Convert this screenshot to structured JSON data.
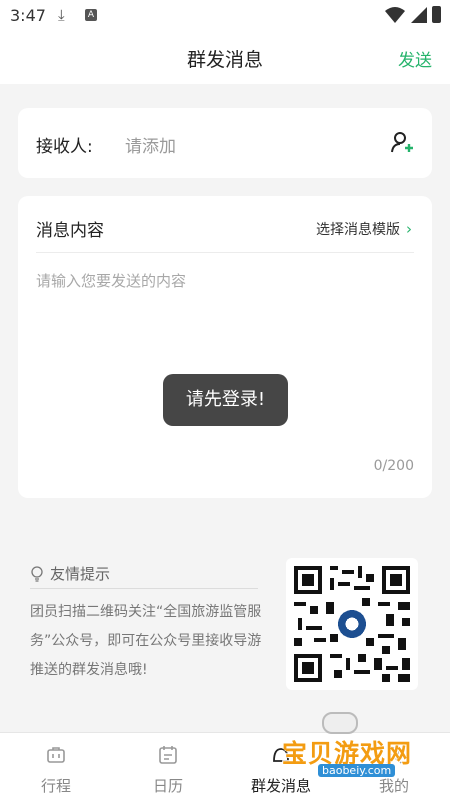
{
  "status": {
    "time": "3:47"
  },
  "nav": {
    "title": "群发消息",
    "send": "发送"
  },
  "recipient": {
    "label": "接收人:",
    "placeholder": "请添加"
  },
  "message": {
    "label": "消息内容",
    "template_link": "选择消息模版",
    "placeholder": "请输入您要发送的内容",
    "counter": "0/200"
  },
  "toast": "请先登录!",
  "tips": {
    "title": "友情提示",
    "text": "团员扫描二维码关注“全国旅游监管服务”公众号，即可在公众号里接收导游推送的群发消息哦!"
  },
  "tabs": [
    {
      "label": "行程",
      "icon": "suitcase-icon",
      "active": false
    },
    {
      "label": "日历",
      "icon": "calendar-icon",
      "active": false
    },
    {
      "label": "群发消息",
      "icon": "message-icon",
      "active": true
    },
    {
      "label": "我的",
      "icon": "profile-icon",
      "active": false
    }
  ],
  "watermark": {
    "text": "宝贝游戏网",
    "url": "baobeiy.com"
  },
  "colors": {
    "accent": "#25b36b",
    "toast_bg": "#3c3c3c",
    "background": "#f4f4f4"
  }
}
